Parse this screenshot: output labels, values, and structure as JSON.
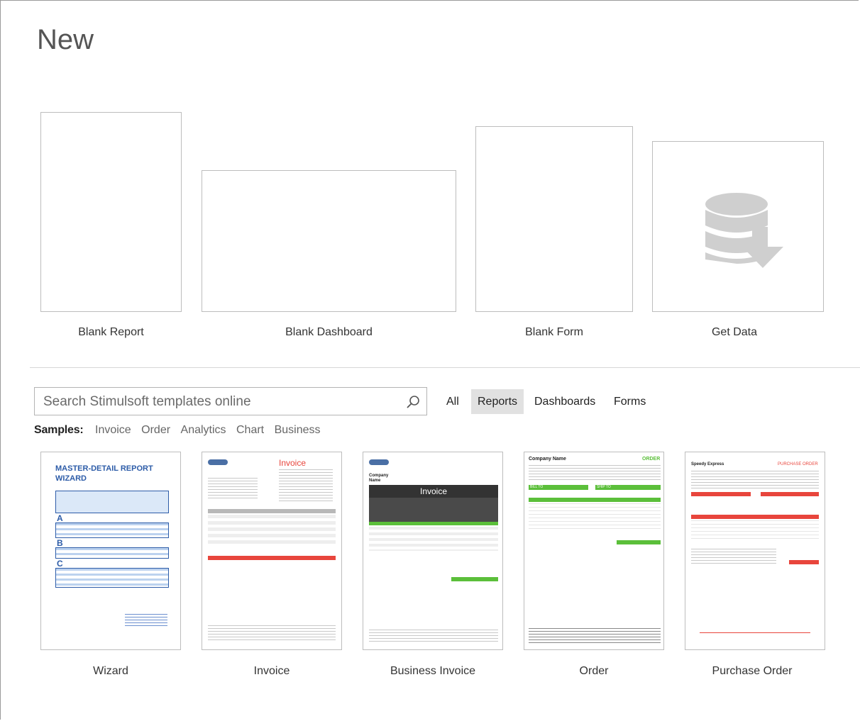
{
  "page": {
    "title": "New"
  },
  "tiles": [
    {
      "label": "Blank Report"
    },
    {
      "label": "Blank Dashboard"
    },
    {
      "label": "Blank Form"
    },
    {
      "label": "Get Data"
    }
  ],
  "search": {
    "placeholder": "Search Stimulsoft templates online"
  },
  "filters": [
    {
      "label": "All",
      "active": false
    },
    {
      "label": "Reports",
      "active": true
    },
    {
      "label": "Dashboards",
      "active": false
    },
    {
      "label": "Forms",
      "active": false
    }
  ],
  "samples": {
    "label": "Samples:",
    "links": [
      "Invoice",
      "Order",
      "Analytics",
      "Chart",
      "Business"
    ]
  },
  "templates": [
    {
      "label": "Wizard",
      "thumb": {
        "title": "MASTER-DETAIL REPORT WIZARD",
        "groups": [
          "A",
          "B",
          "C"
        ]
      }
    },
    {
      "label": "Invoice",
      "thumb": {
        "heading": "Invoice"
      }
    },
    {
      "label": "Business Invoice",
      "thumb": {
        "heading": "Invoice",
        "company": "Company Name"
      }
    },
    {
      "label": "Order",
      "thumb": {
        "company": "Company Name",
        "heading": "ORDER",
        "bill_to": "BILL TO",
        "ship_to": "SHIP TO"
      }
    },
    {
      "label": "Purchase Order",
      "thumb": {
        "company": "Speedy Express",
        "heading": "PURCHASE ORDER"
      }
    }
  ],
  "colors": {
    "accent_red": "#e8453c",
    "accent_green": "#5bbf3a",
    "wizard_blue": "#2d5ca8",
    "filter_active_bg": "#e1e1e1"
  }
}
